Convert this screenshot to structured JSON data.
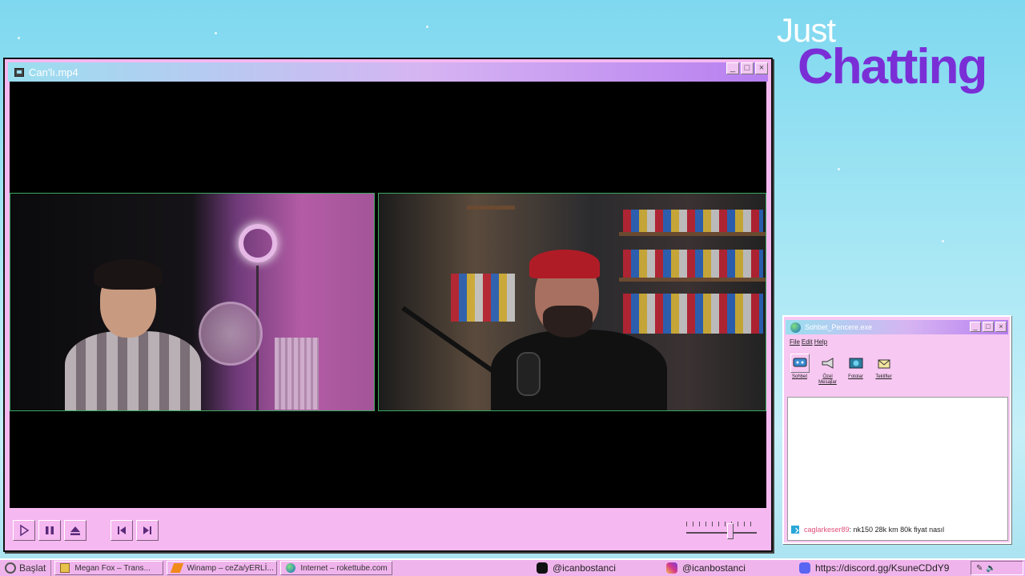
{
  "overlay": {
    "title_small": "Just",
    "title_large": "Chatting"
  },
  "main_window": {
    "title": "Can'lı.mp4",
    "volume_level": 0.62
  },
  "chat_window": {
    "title": "Sohbet_Pencere.exe",
    "menu": [
      "File",
      "Edit",
      "Help"
    ],
    "tools": [
      {
        "label": "Sohbet",
        "icon": "chat-icon"
      },
      {
        "label": "Özel Mesajlar",
        "icon": "megaphone-icon"
      },
      {
        "label": "Fotolar",
        "icon": "photos-icon"
      },
      {
        "label": "Teklifler",
        "icon": "mail-icon"
      }
    ],
    "messages": [
      {
        "user": "caglarkeser89",
        "text": ": nk150 28k km 80k fiyat nasıl"
      }
    ]
  },
  "taskbar": {
    "start_label": "Başlat",
    "tasks": [
      {
        "label": "Megan Fox – Trans..."
      },
      {
        "label": "Winamp – ceZa/yERLİ..."
      },
      {
        "label": "Internet – rokettube.com"
      }
    ],
    "tiktok": "@icanbostanci",
    "instagram": "@icanbostanci",
    "discord": "https://discord.gg/KsuneCDdY9"
  },
  "colors": {
    "accent": "#7a2fd6",
    "window_pink": "#f5b8f0",
    "chat_user": "#e0507a"
  }
}
